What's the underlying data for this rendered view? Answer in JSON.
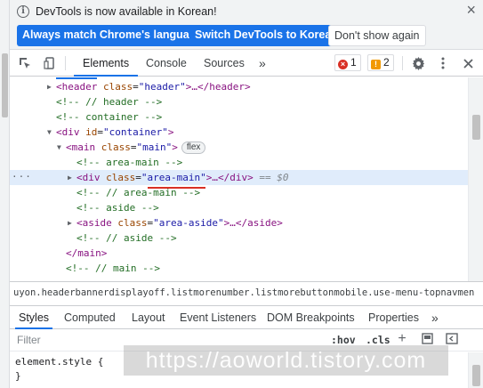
{
  "infobar": {
    "message": "DevTools is now available in Korean!",
    "btn_match": "Always match Chrome's language",
    "btn_switch": "Switch DevTools to Korean",
    "btn_dismiss": "Don't show again",
    "close": "×"
  },
  "toolbar": {
    "tabs": [
      "Elements",
      "Console",
      "Sources"
    ],
    "more": "»",
    "errors": "1",
    "warnings": "2",
    "error_color": "#d93025",
    "warning_color": "#f29900"
  },
  "tree": {
    "header_open": "<header",
    "header_attr": "class",
    "header_val": "\"header\"",
    "header_close": ">…</header>",
    "c1": "<!-- // header -->",
    "c2": "<!-- container -->",
    "div_open": "<div",
    "div_attr": "id",
    "div_val": "\"container\"",
    "div_close": ">",
    "main_open": "<main",
    "main_attr": "class",
    "main_val": "\"main\"",
    "main_close": ">",
    "flex_badge": "flex",
    "c3": "<!-- area-main -->",
    "sel_open": "<div",
    "sel_attr": "class",
    "sel_val": "\"area-main\"",
    "sel_close": ">…</div>",
    "sel_eq": "== $0",
    "sel_dots": "···",
    "c4": "<!-- // area-main -->",
    "c5": "<!-- aside -->",
    "aside_open": "<aside",
    "aside_attr": "class",
    "aside_val": "\"area-aside\"",
    "aside_close": ">…</aside>",
    "c6": "<!-- // aside -->",
    "main_end": "</main>",
    "c7": "<!-- // main -->"
  },
  "breadcrumb": "uyon.headerbannerdisplayoff.listmorenumber.listmorebuttonmobile.use-menu-topnavmen",
  "subtabs": [
    "Styles",
    "Computed",
    "Layout",
    "Event Listeners",
    "DOM Breakpoints",
    "Properties"
  ],
  "subtabs_more": "»",
  "filter": {
    "placeholder": "Filter",
    "hov": ":hov",
    "cls": ".cls",
    "plus": "+"
  },
  "styles": {
    "rule": "element.style {",
    "close": "}"
  },
  "watermark": "https://aoworld.tistory.com"
}
